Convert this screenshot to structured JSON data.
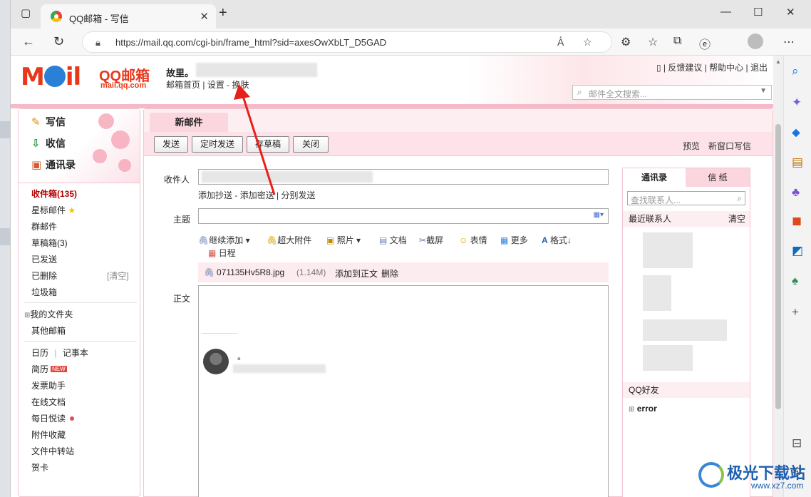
{
  "browser": {
    "tab_title": "QQ邮箱 - 写信",
    "url": "https://mail.qq.com/cgi-bin/frame_html?sid=axesOwXbLT_D5GAD"
  },
  "header": {
    "logo_text": "MOil",
    "logo_brand": "QQ邮箱",
    "logo_domain": "mail.qq.com",
    "username": "故里。",
    "links": [
      "邮箱首页",
      "设置",
      "换肤"
    ],
    "right_links": [
      "反馈建议",
      "帮助中心",
      "退出"
    ],
    "search_placeholder": "邮件全文搜索..."
  },
  "leftnav": {
    "compose": "写信",
    "inbox_check": "收信",
    "contacts": "通讯录",
    "folders": {
      "inbox": "收件箱(135)",
      "starred": "星标邮件",
      "group": "群邮件",
      "drafts": "草稿箱(3)",
      "sent": "已发送",
      "deleted": "已删除",
      "clear": "[清空]",
      "spam": "垃圾箱",
      "my_folders": "我的文件夹",
      "other_mail": "其他邮箱",
      "calendar": "日历",
      "notebook": "记事本",
      "resume": "简历",
      "new_badge": "NEW",
      "invoice": "发票助手",
      "online_docs": "在线文档",
      "daily": "每日悦读",
      "attachments": "附件收藏",
      "file_transfer": "文件中转站",
      "greeting": "贺卡"
    }
  },
  "compose": {
    "tab_label": "新邮件",
    "buttons": {
      "send": "发送",
      "timed": "定时发送",
      "save": "存草稿",
      "close": "关闭"
    },
    "preview": "预览",
    "new_window": "新窗口写信",
    "to_label": "收件人",
    "cc_links": [
      "添加抄送",
      "添加密送",
      "分别发送"
    ],
    "subject_label": "主题",
    "body_label": "正文",
    "attach_tools": {
      "continue_add": "继续添加",
      "large_attach": "超大附件",
      "photo": "照片",
      "doc": "文档",
      "screenshot": "截屏",
      "emoji": "表情",
      "more": "更多",
      "format": "格式↓",
      "schedule": "日程"
    },
    "attachment": {
      "name": "071135Hv5R8.jpg",
      "size": "(1.14M)",
      "add_to_body": "添加到正文",
      "delete": "删除"
    },
    "signature_dot": "。"
  },
  "contacts_panel": {
    "tab_contacts": "通讯录",
    "tab_paper": "信 纸",
    "search_placeholder": "查找联系人...",
    "recent": "最近联系人",
    "clear": "清空",
    "qq_friends": "QQ好友",
    "group_error": "error"
  },
  "watermark": {
    "title": "极光下载站",
    "domain": "www.xz7.com"
  },
  "colors": {
    "accent_pink": "#f6b9c7",
    "brand_red": "#e8381b",
    "annotation_red": "#e8201a"
  }
}
